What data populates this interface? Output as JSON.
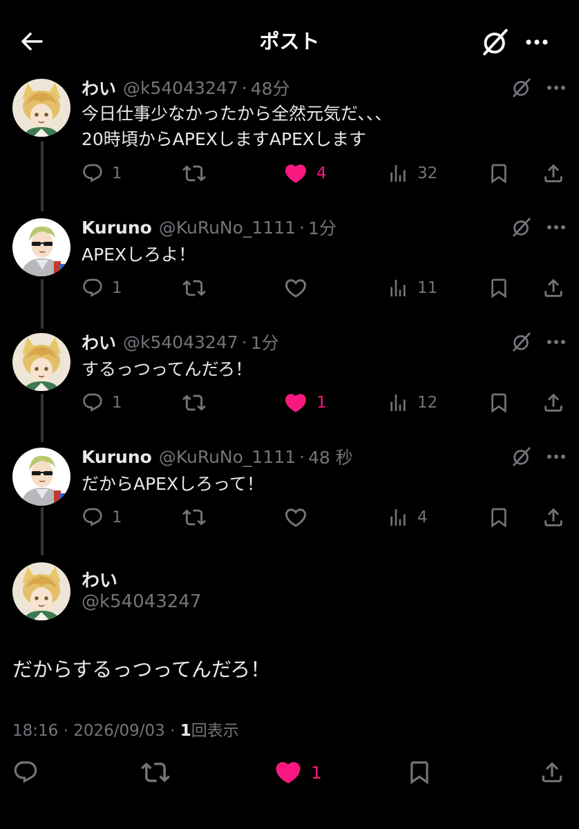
{
  "header": {
    "title": "ポスト"
  },
  "thread": [
    {
      "name": "わい",
      "handle": "@k54043247",
      "time": "48分",
      "text": [
        "今日仕事少なかったから全然元気だ、、、",
        "20時頃からAPEXしますAPEXします"
      ],
      "replies": "1",
      "reposts": "",
      "likes": "4",
      "liked": true,
      "views": "32",
      "avatar": "fox-boy-avatar"
    },
    {
      "name": "Kuruno",
      "handle": "@KuRuNo_1111",
      "time": "1分",
      "text": [
        "APEXしろよ！"
      ],
      "replies": "1",
      "reposts": "",
      "likes": "",
      "liked": false,
      "views": "11",
      "avatar": "sunglasses-boy-avatar"
    },
    {
      "name": "わい",
      "handle": "@k54043247",
      "time": "1分",
      "text": [
        "するっつってんだろ！"
      ],
      "replies": "1",
      "reposts": "",
      "likes": "1",
      "liked": true,
      "views": "12",
      "avatar": "fox-boy-avatar"
    },
    {
      "name": "Kuruno",
      "handle": "@KuRuNo_1111",
      "time": "48 秒",
      "text": [
        "だからAPEXしろって！"
      ],
      "replies": "1",
      "reposts": "",
      "likes": "",
      "liked": false,
      "views": "4",
      "avatar": "sunglasses-boy-avatar"
    }
  ],
  "main": {
    "name": "わい",
    "handle": "@k54043247",
    "text": "だからするっつってんだろ！",
    "timestamp": "18:16 · 2026/09/03 · ",
    "views_count": "1",
    "views_label": "回表示",
    "likes": "1",
    "liked": true,
    "avatar": "fox-boy-avatar"
  },
  "colors": {
    "background": "#000000",
    "text_primary": "#e7e9ea",
    "text_secondary": "#71767b",
    "like_pink": "#f91880",
    "thread_line": "#333639"
  }
}
